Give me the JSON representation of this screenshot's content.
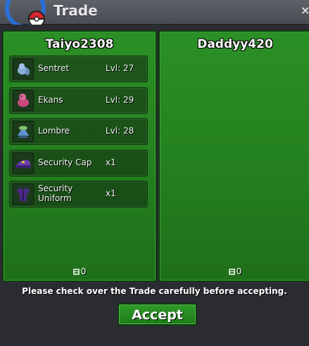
{
  "window": {
    "title": "Trade",
    "close_symbol": "×"
  },
  "left_player": {
    "name": "Taiyo2308",
    "items": [
      {
        "name": "Sentret",
        "level": "Lvl: 27",
        "icon": "sentret-sprite-icon"
      },
      {
        "name": "Ekans",
        "level": "Lvl: 29",
        "icon": "ekans-sprite-icon"
      },
      {
        "name": "Lombre",
        "level": "Lvl: 28",
        "icon": "lombre-sprite-icon"
      },
      {
        "name": "Security Cap",
        "qty": "x1",
        "icon": "security-cap-icon"
      },
      {
        "name": "Security\nUniform",
        "qty": "x1",
        "icon": "security-uniform-icon"
      }
    ],
    "money": "0"
  },
  "right_player": {
    "name": "Daddyy420",
    "money": "0"
  },
  "notice": "Please check over the Trade carefully before accepting.",
  "accept_label": "Accept",
  "colors": {
    "panel_green": "#26851f",
    "accept_green": "#2a8f24"
  }
}
